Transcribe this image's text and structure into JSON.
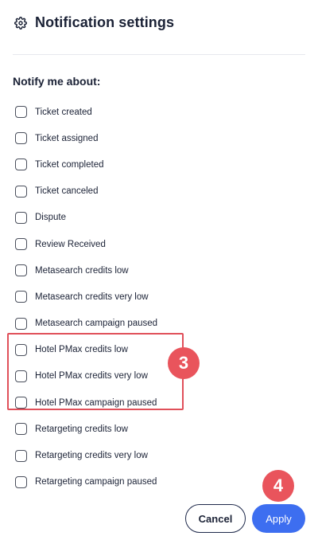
{
  "header": {
    "title": "Notification settings",
    "icon": "gear-icon"
  },
  "section_label": "Notify me about:",
  "options": [
    {
      "label": "Ticket created",
      "checked": false
    },
    {
      "label": "Ticket assigned",
      "checked": false
    },
    {
      "label": "Ticket completed",
      "checked": false
    },
    {
      "label": "Ticket canceled",
      "checked": false
    },
    {
      "label": "Dispute",
      "checked": false
    },
    {
      "label": "Review Received",
      "checked": false
    },
    {
      "label": "Metasearch credits low",
      "checked": false
    },
    {
      "label": "Metasearch credits very low",
      "checked": false
    },
    {
      "label": "Metasearch campaign paused",
      "checked": false
    },
    {
      "label": "Hotel PMax credits low",
      "checked": false
    },
    {
      "label": "Hotel PMax credits very low",
      "checked": false
    },
    {
      "label": "Hotel PMax campaign paused",
      "checked": false
    },
    {
      "label": "Retargeting credits low",
      "checked": false
    },
    {
      "label": "Retargeting credits very low",
      "checked": false
    },
    {
      "label": "Retargeting campaign paused",
      "checked": false
    }
  ],
  "annotations": {
    "step_3": "3",
    "step_4": "4",
    "color": "#e9545c"
  },
  "buttons": {
    "cancel": "Cancel",
    "apply": "Apply",
    "apply_color": "#3d6ef0"
  }
}
